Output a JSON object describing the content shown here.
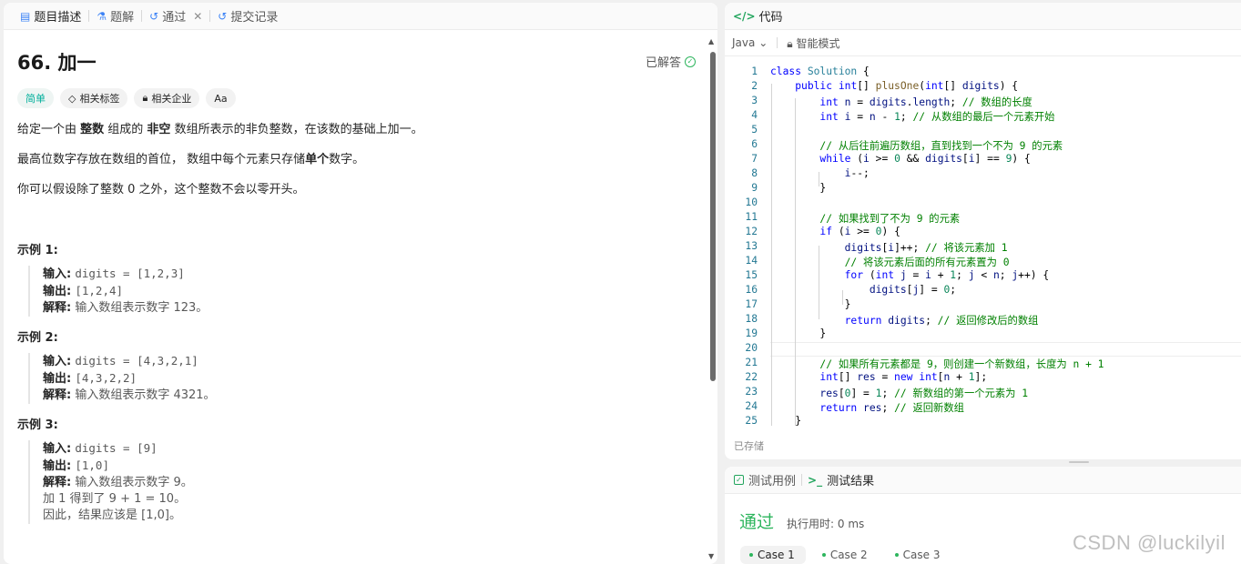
{
  "left_tabs": [
    {
      "label": "题目描述",
      "icon": "doc-icon"
    },
    {
      "label": "题解",
      "icon": "flask-icon"
    },
    {
      "label": "通过",
      "icon": "history-icon"
    },
    {
      "label": "提交记录",
      "icon": "history-icon"
    }
  ],
  "problem": {
    "title": "66. 加一",
    "solved_label": "已解答",
    "tags": [
      "简单",
      "相关标签",
      "相关企业",
      "Aa"
    ],
    "p1_a": "给定一个由 ",
    "p1_b": "整数",
    "p1_c": " 组成的 ",
    "p1_d": "非空",
    "p1_e": " 数组所表示的非负整数，在该数的基础上加一。",
    "p2_a": "最高位数字存放在数组的首位， 数组中每个元素只存储",
    "p2_b": "单个",
    "p2_c": "数字。",
    "p3": "你可以假设除了整数 0 之外，这个整数不会以零开头。",
    "examples": [
      {
        "title": "示例 1:",
        "input_label": "输入:",
        "input": "digits = [1,2,3]",
        "output_label": "输出:",
        "output": "[1,2,4]",
        "explain_label": "解释:",
        "explain": "输入数组表示数字 123。"
      },
      {
        "title": "示例 2:",
        "input_label": "输入:",
        "input": "digits = [4,3,2,1]",
        "output_label": "输出:",
        "output": "[4,3,2,2]",
        "explain_label": "解释:",
        "explain": "输入数组表示数字 4321。"
      },
      {
        "title": "示例 3:",
        "input_label": "输入:",
        "input": "digits = [9]",
        "output_label": "输出:",
        "output": "[1,0]",
        "explain_label": "解释:",
        "explain": "输入数组表示数字 9。",
        "extra1": "加 1 得到了 9 + 1 = 10。",
        "extra2": "因此，结果应该是 [1,0]。"
      }
    ]
  },
  "code_panel": {
    "title": "代码",
    "language": "Java",
    "mode": "智能模式",
    "saved_label": "已存储",
    "line_numbers": [
      "1",
      "2",
      "3",
      "4",
      "5",
      "6",
      "7",
      "8",
      "9",
      "10",
      "11",
      "12",
      "13",
      "14",
      "15",
      "16",
      "17",
      "18",
      "19",
      "20",
      "21",
      "22",
      "23",
      "24",
      "25"
    ]
  },
  "result_panel": {
    "tab_cases": "测试用例",
    "tab_result": "测试结果",
    "status": "通过",
    "runtime": "执行用时: 0 ms",
    "cases": [
      "Case 1",
      "Case 2",
      "Case 3"
    ]
  },
  "watermark": "CSDN @luckilyil",
  "colors": {
    "accent_green": "#2db55d",
    "easy_teal": "#00af9b",
    "line_number": "#237893"
  }
}
